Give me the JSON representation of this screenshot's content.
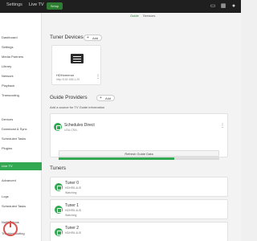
{
  "topbar": {
    "title": "Settings",
    "section": "Live TV",
    "badge": "Setup",
    "icons": [
      "cast-icon",
      "activity-icon",
      "user-icon"
    ]
  },
  "sidebar": {
    "items": [
      {
        "label": "Dashboard",
        "active": false
      },
      {
        "label": "Settings",
        "active": false
      },
      {
        "label": "Media Partners",
        "active": false
      },
      {
        "label": "Library",
        "active": false
      },
      {
        "label": "Network",
        "active": false
      },
      {
        "label": "Playback",
        "active": false
      },
      {
        "label": "Transcoding",
        "active": false
      },
      {
        "label": "Devices",
        "active": false
      },
      {
        "label": "Download & Sync",
        "active": false
      },
      {
        "label": "Scheduled Tasks",
        "active": false
      },
      {
        "label": "Plugins",
        "active": false
      },
      {
        "label": "Live TV",
        "active": true
      },
      {
        "label": "Advanced",
        "active": false
      },
      {
        "label": "Logs",
        "active": false
      },
      {
        "label": "Scheduled Tasks",
        "active": false
      },
      {
        "label": "Notifications",
        "active": false
      },
      {
        "label": "Troubleshooting",
        "active": false
      }
    ]
  },
  "main": {
    "tabs": [
      {
        "label": "Guide",
        "active": true
      },
      {
        "label": "Services",
        "active": false
      }
    ],
    "tuner_devices": {
      "title": "Tuner Devices",
      "add_label": "Add",
      "device": {
        "name": "HDHomerun",
        "ip": "http://192.168.1.20"
      }
    },
    "guide_providers": {
      "title": "Guide Providers",
      "add_label": "Add",
      "hint": "Add a source for TV Guide information",
      "provider": {
        "name": "Schedules Direct",
        "region": "USA-CRA-"
      },
      "refresh_label": "Refresh Guide Data",
      "progress_fraction": 0.72
    },
    "tuners": {
      "title": "Tuners",
      "items": [
        {
          "name": "Tuner 0",
          "model": "HDHR5-4US",
          "status": "Watching"
        },
        {
          "name": "Tuner 1",
          "model": "HDHR5-4US",
          "status": "Watching"
        },
        {
          "name": "Tuner 2",
          "model": "HDHR5-4US",
          "status": ""
        }
      ]
    }
  },
  "colors": {
    "accent": "#32a852",
    "topbar": "#1f1f1f",
    "background": "#f3f3f3"
  }
}
